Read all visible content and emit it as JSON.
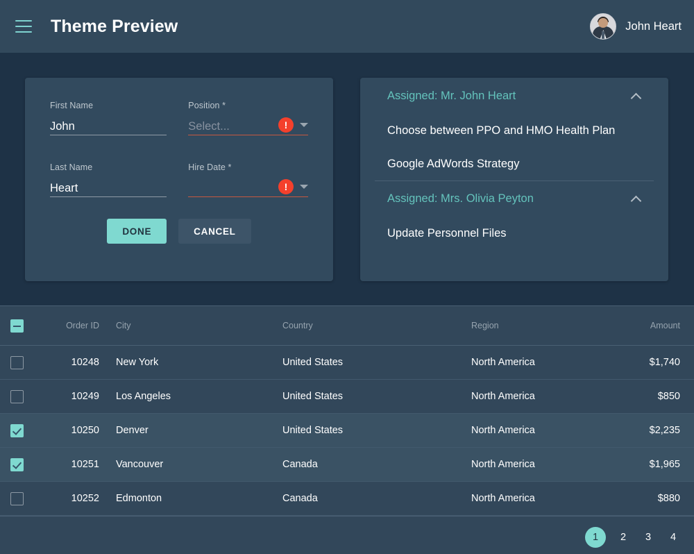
{
  "header": {
    "menu_icon": "hamburger-icon",
    "title": "Theme Preview",
    "user_name": "John Heart",
    "avatar_icon": "user-avatar"
  },
  "form": {
    "fields": [
      {
        "label": "First Name",
        "required": false,
        "value": "John",
        "placeholder": "",
        "invalid": false,
        "dropdown": false
      },
      {
        "label": "Position *",
        "required": true,
        "value": "",
        "placeholder": "Select...",
        "invalid": true,
        "dropdown": true
      },
      {
        "label": "Last Name",
        "required": false,
        "value": "Heart",
        "placeholder": "",
        "invalid": false,
        "dropdown": false
      },
      {
        "label": "Hire Date *",
        "required": true,
        "value": "",
        "placeholder": "",
        "invalid": true,
        "dropdown": true
      }
    ],
    "error_glyph": "!",
    "done_label": "DONE",
    "cancel_label": "CANCEL"
  },
  "accordion": {
    "groups": [
      {
        "title": "Assigned: Mr. John Heart",
        "items": [
          "Choose between PPO and HMO Health Plan",
          "Google AdWords Strategy"
        ]
      },
      {
        "title": "Assigned: Mrs. Olivia Peyton",
        "items": [
          "Update Personnel Files"
        ]
      }
    ]
  },
  "grid": {
    "columns": [
      "Order ID",
      "City",
      "Country",
      "Region",
      "Amount"
    ],
    "select_all_state": "indeterminate",
    "rows": [
      {
        "selected": false,
        "order_id": "10248",
        "city": "New York",
        "country": "United States",
        "region": "North America",
        "amount": "$1,740"
      },
      {
        "selected": false,
        "order_id": "10249",
        "city": "Los Angeles",
        "country": "United States",
        "region": "North America",
        "amount": "$850"
      },
      {
        "selected": true,
        "order_id": "10250",
        "city": "Denver",
        "country": "United States",
        "region": "North America",
        "amount": "$2,235"
      },
      {
        "selected": true,
        "order_id": "10251",
        "city": "Vancouver",
        "country": "Canada",
        "region": "North America",
        "amount": "$1,965"
      },
      {
        "selected": false,
        "order_id": "10252",
        "city": "Edmonton",
        "country": "Canada",
        "region": "North America",
        "amount": "$880"
      }
    ]
  },
  "pagination": {
    "pages": [
      "1",
      "2",
      "3",
      "4"
    ],
    "active": "1"
  },
  "colors": {
    "page_bg": "#1e3246",
    "header_bg": "#32495c",
    "card_bg": "#324a5e",
    "accent": "#7fd9d0",
    "accent_text": "#64c3bc",
    "error": "#f4402c",
    "row_selected_bg": "#3a5264"
  }
}
